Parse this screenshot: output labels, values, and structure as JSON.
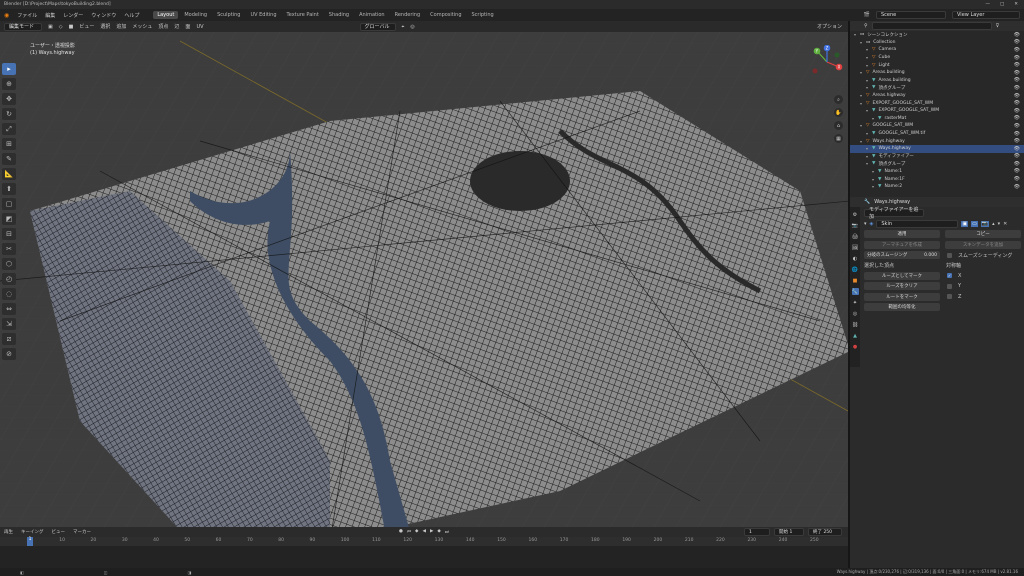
{
  "titlebar": {
    "title": "Blender [D:\\Project\\Maps\\tokyoBuilding2.blend]",
    "min": "—",
    "max": "□",
    "close": "✕"
  },
  "menubar": {
    "menus": [
      "ファイル",
      "編集",
      "レンダー",
      "ウィンドウ",
      "ヘルプ"
    ],
    "workspaces": [
      "Layout",
      "Modeling",
      "Sculpting",
      "UV Editing",
      "Texture Paint",
      "Shading",
      "Animation",
      "Rendering",
      "Compositing",
      "Scripting"
    ],
    "active_workspace": "Layout",
    "scene": "Scene",
    "view_layer": "View Layer"
  },
  "viewport_header": {
    "mode": "編集モード",
    "menus": [
      "ビュー",
      "選択",
      "追加",
      "メッシュ",
      "頂点",
      "辺",
      "面",
      "UV"
    ],
    "transform": "グローバル",
    "options": "オプション"
  },
  "viewport_overlay": {
    "view_name": "ユーザー・透視投影",
    "object_name": "(1) Ways.highway"
  },
  "gizmo": {
    "x": "X",
    "y": "Y",
    "z": "Z"
  },
  "timeline": {
    "menus": [
      "再生",
      "キーイング",
      "ビュー",
      "マーカー"
    ],
    "current_frame": "1",
    "start_label": "開始",
    "start": "1",
    "end_label": "終了",
    "end": "250",
    "ruler": [
      "1",
      "10",
      "20",
      "30",
      "40",
      "50",
      "60",
      "70",
      "80",
      "90",
      "100",
      "110",
      "120",
      "130",
      "140",
      "150",
      "160",
      "170",
      "180",
      "190",
      "200",
      "210",
      "220",
      "230",
      "240",
      "250"
    ]
  },
  "statusbar": {
    "stats": "Ways.highway | 頂点:0/230,276 | 辺:0/319,136 | 面:0/0 | 三角面:0 | メモリ:674 MB | v2.81.16"
  },
  "outliner": {
    "header": "シーンコレクション",
    "rows": [
      {
        "label": "シーンコレクション",
        "indent": 0,
        "icon": "coll"
      },
      {
        "label": "Collection",
        "indent": 1,
        "icon": "coll"
      },
      {
        "label": "Camera",
        "indent": 2,
        "icon": "obj"
      },
      {
        "label": "Cube",
        "indent": 2,
        "icon": "obj"
      },
      {
        "label": "Light",
        "indent": 2,
        "icon": "obj"
      },
      {
        "label": "Areas.building",
        "indent": 1,
        "icon": "obj"
      },
      {
        "label": "Areas.building",
        "indent": 2,
        "icon": "mesh"
      },
      {
        "label": "頂点グループ",
        "indent": 2,
        "icon": "mesh"
      },
      {
        "label": "Areas.highway",
        "indent": 1,
        "icon": "obj"
      },
      {
        "label": "EXPORT_GOOGLE_SAT_WM",
        "indent": 1,
        "icon": "obj"
      },
      {
        "label": "EXPORT_GOOGLE_SAT_WM",
        "indent": 2,
        "icon": "mesh"
      },
      {
        "label": "rasterMat",
        "indent": 3,
        "icon": "mesh"
      },
      {
        "label": "GOOGLE_SAT_WM",
        "indent": 1,
        "icon": "obj"
      },
      {
        "label": "GOOGLE_SAT_WM.tif",
        "indent": 2,
        "icon": "mesh"
      },
      {
        "label": "Ways.highway",
        "indent": 1,
        "icon": "obj"
      },
      {
        "label": "Ways.highway",
        "indent": 2,
        "icon": "mesh",
        "selected": true
      },
      {
        "label": "モディファイアー",
        "indent": 2,
        "icon": "mesh"
      },
      {
        "label": "頂点グループ",
        "indent": 2,
        "icon": "mesh"
      },
      {
        "label": "Name:1",
        "indent": 3,
        "icon": "mesh"
      },
      {
        "label": "Name:1F",
        "indent": 3,
        "icon": "mesh"
      },
      {
        "label": "Name:2",
        "indent": 3,
        "icon": "mesh"
      }
    ]
  },
  "properties": {
    "object": "Ways.highway",
    "add_modifier": "モディファイアーを追加",
    "modifier_name": "Skin",
    "apply": "適用",
    "copy": "コピー",
    "create_armature": "アーマチュアを作成",
    "skin_data": "スキンデータを追加",
    "branch_smoothing_label": "分岐のスムージング",
    "branch_smoothing": "0.000",
    "smooth_shading": "スムーズシェーディング",
    "selected_vertices": "選択した頂点",
    "symmetry": "対称軸",
    "mark_loose": "ルーズとしてマーク",
    "clear_loose": "ルーズをクリア",
    "mark_root": "ルートをマーク",
    "equalize_radii": "範囲の均等化",
    "axes": [
      "X",
      "Y",
      "Z"
    ]
  }
}
